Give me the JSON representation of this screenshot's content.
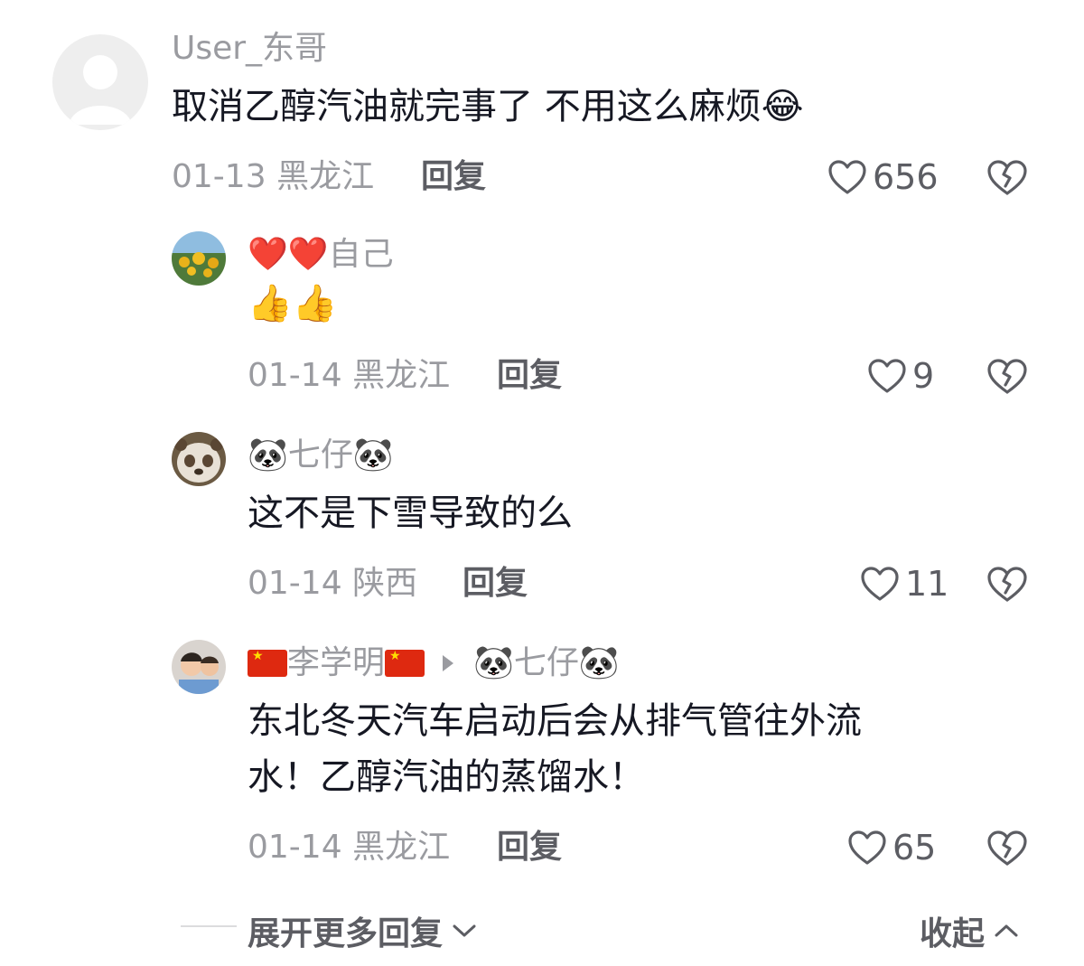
{
  "comments": [
    {
      "username": "User_东哥",
      "text": "取消乙醇汽油就完事了 不用这么麻烦",
      "text_emoji": "😂",
      "date": "01-13",
      "location": "黑龙江",
      "reply_label": "回复",
      "likes": "656"
    },
    {
      "username_emoji": "❤️❤️",
      "username": "自己",
      "text": "👍👍",
      "date": "01-14",
      "location": "黑龙江",
      "reply_label": "回复",
      "likes": "9"
    },
    {
      "username_prefix_emoji": "🐼",
      "username": "七仔",
      "username_suffix_emoji": "🐼",
      "text": "这不是下雪导致的么",
      "date": "01-14",
      "location": "陕西",
      "reply_label": "回复",
      "likes": "11"
    },
    {
      "username": "李学明",
      "reply_to_prefix_emoji": "🐼",
      "reply_to": "七仔",
      "reply_to_suffix_emoji": "🐼",
      "text_line1": "东北冬天汽车启动后会从排气管往外流",
      "text_line2": "水！乙醇汽油的蒸馏水！",
      "date": "01-14",
      "location": "黑龙江",
      "reply_label": "回复",
      "likes": "65"
    }
  ],
  "footer": {
    "expand_label": "展开更多回复",
    "collapse_label": "收起"
  },
  "colors": {
    "text": "#161823",
    "secondary": "#9a9ba0",
    "action": "#5c5d63"
  }
}
